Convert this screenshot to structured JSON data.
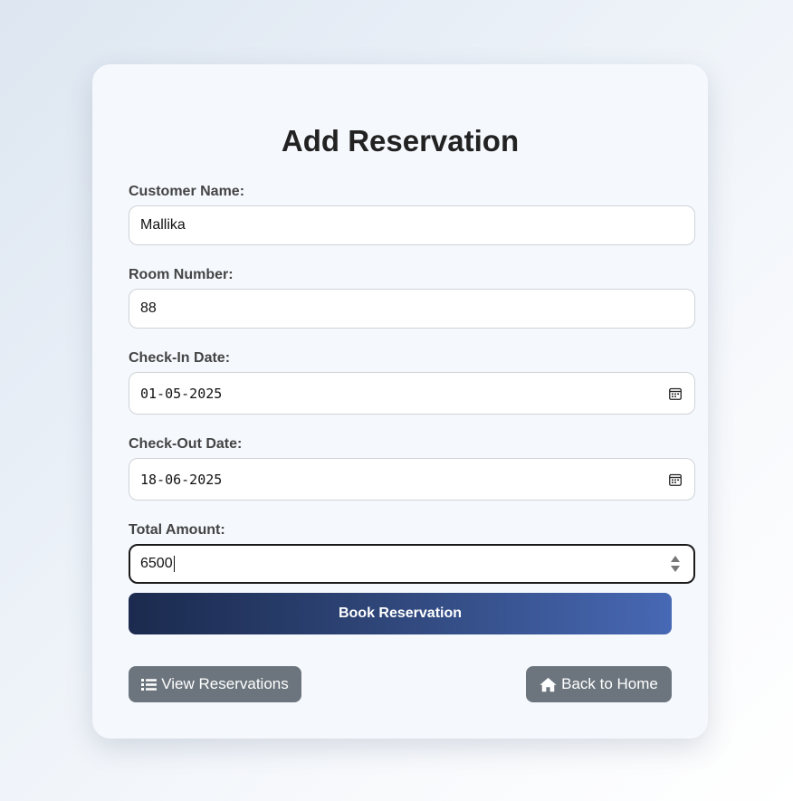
{
  "form": {
    "title": "Add Reservation",
    "fields": {
      "customer_name": {
        "label": "Customer Name:",
        "value": "Mallika"
      },
      "room_number": {
        "label": "Room Number:",
        "value": "88"
      },
      "check_in": {
        "label": "Check-In Date:",
        "value": "01-05-2025",
        "icon": "calendar-icon"
      },
      "check_out": {
        "label": "Check-Out Date:",
        "value": "18-06-2025",
        "icon": "calendar-icon"
      },
      "total_amount": {
        "label": "Total Amount:",
        "value": "6500",
        "icon": "spinner-arrows-icon"
      }
    },
    "submit_label": "Book Reservation"
  },
  "nav": {
    "view_label": "View Reservations",
    "view_icon": "list-icon",
    "home_label": "Back to Home",
    "home_icon": "home-icon"
  },
  "colors": {
    "button_gradient_start": "#1b2a4e",
    "button_gradient_end": "#4768b4",
    "secondary_button": "#6c757d",
    "card_background": "#f5f8fd"
  }
}
